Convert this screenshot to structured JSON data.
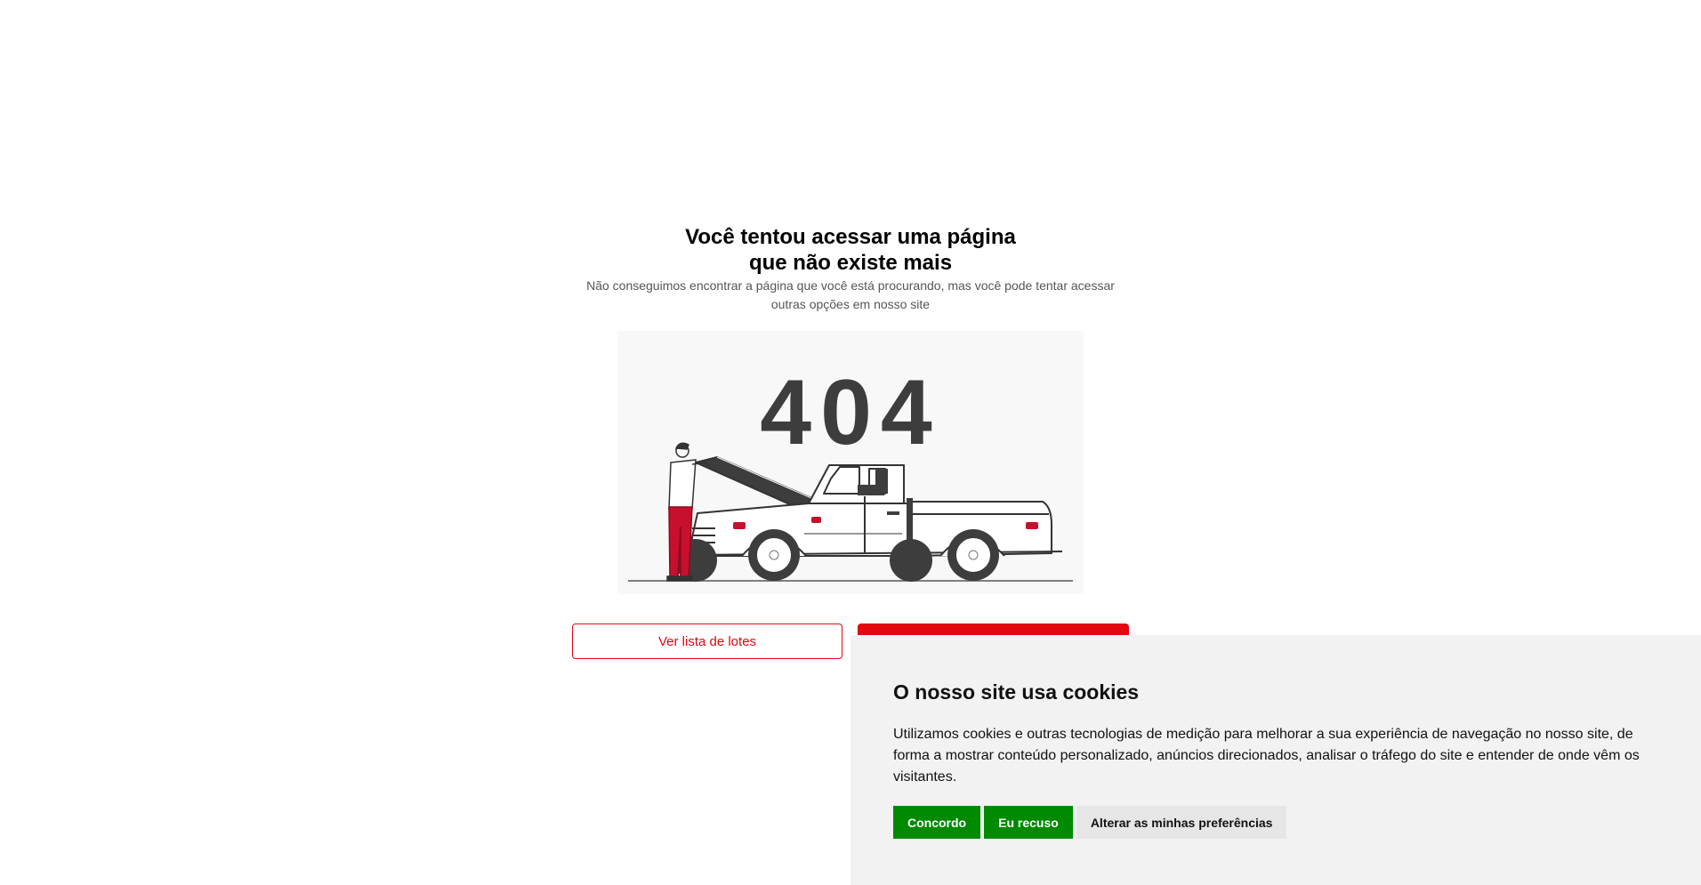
{
  "error": {
    "title_line1": "Você tentou acessar uma página",
    "title_line2": "que não existe mais",
    "subtitle": "Não conseguimos encontrar a página que você está procurando, mas você pode tentar acessar outras opções em nosso site",
    "code": "404"
  },
  "actions": {
    "lots_label": "Ver lista de lotes",
    "second_label": ""
  },
  "cookies": {
    "title": "O nosso site usa cookies",
    "text": "Utilizamos cookies e outras tecnologias de medição para melhorar a sua experiência de navegação no nosso site, de forma a mostrar conteúdo personalizado, anúncios direcionados, analisar o tráfego do site e entender de onde vêm os visitantes.",
    "accept_label": "Concordo",
    "refuse_label": "Eu recuso",
    "prefs_label": "Alterar as minhas preferências"
  },
  "colors": {
    "brand_red": "#e30613",
    "cookie_green": "#008a00",
    "cookie_panel_bg": "#f2f2f2"
  },
  "icons": {
    "illustration": "mechanic-pickup-truck-illustration"
  }
}
